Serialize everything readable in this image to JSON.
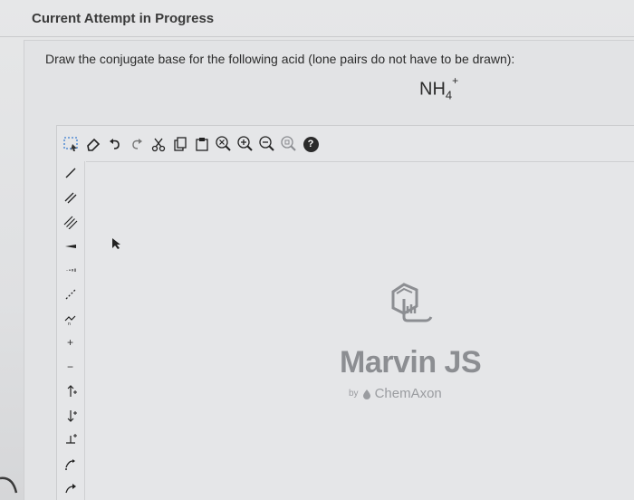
{
  "heading": "Current Attempt in Progress",
  "question": {
    "text": "Draw the conjugate base for the following acid (lone pairs do not have to be drawn):",
    "formula": {
      "base": "NH",
      "subscript": "4",
      "superscript": "+"
    }
  },
  "editor": {
    "top_toolbar": [
      {
        "name": "select-tool",
        "icon": "selection-rectangle-icon"
      },
      {
        "name": "erase-tool",
        "icon": "eraser-icon"
      },
      {
        "name": "undo",
        "icon": "undo-icon"
      },
      {
        "name": "redo",
        "icon": "redo-icon"
      },
      {
        "name": "cut",
        "icon": "scissors-icon"
      },
      {
        "name": "copy",
        "icon": "copy-icon"
      },
      {
        "name": "paste",
        "icon": "paste-icon"
      },
      {
        "name": "zoom-reset",
        "icon": "zoom-x-icon"
      },
      {
        "name": "zoom-in",
        "icon": "zoom-in-icon"
      },
      {
        "name": "zoom-out",
        "icon": "zoom-out-icon"
      },
      {
        "name": "zoom-fit",
        "icon": "zoom-fit-icon"
      },
      {
        "name": "help",
        "icon": "help-icon",
        "label": "?"
      }
    ],
    "left_toolbar": [
      {
        "name": "single-bond",
        "icon": "single-bond-icon"
      },
      {
        "name": "double-bond",
        "icon": "double-bond-icon"
      },
      {
        "name": "triple-bond",
        "icon": "triple-bond-icon"
      },
      {
        "name": "wedge-bond",
        "icon": "wedge-bond-icon"
      },
      {
        "name": "hash-bond",
        "icon": "hashed-bond-icon"
      },
      {
        "name": "dashed-bond",
        "icon": "dashed-bond-icon"
      },
      {
        "name": "chain",
        "icon": "chain-icon"
      },
      {
        "name": "positive-charge",
        "label": "+"
      },
      {
        "name": "negative-charge",
        "label": "−"
      },
      {
        "name": "increase-charge",
        "icon": "charge-up-icon"
      },
      {
        "name": "decrease-charge",
        "icon": "charge-down-icon"
      },
      {
        "name": "arrow-charge",
        "icon": "charge-arrow-icon"
      },
      {
        "name": "electron-flow",
        "icon": "electron-flow-icon"
      },
      {
        "name": "reaction-arrow",
        "icon": "curved-arrow-icon"
      }
    ],
    "watermark": {
      "brand": "Marvin JS",
      "by": "by",
      "vendor": "ChemAxon"
    }
  }
}
